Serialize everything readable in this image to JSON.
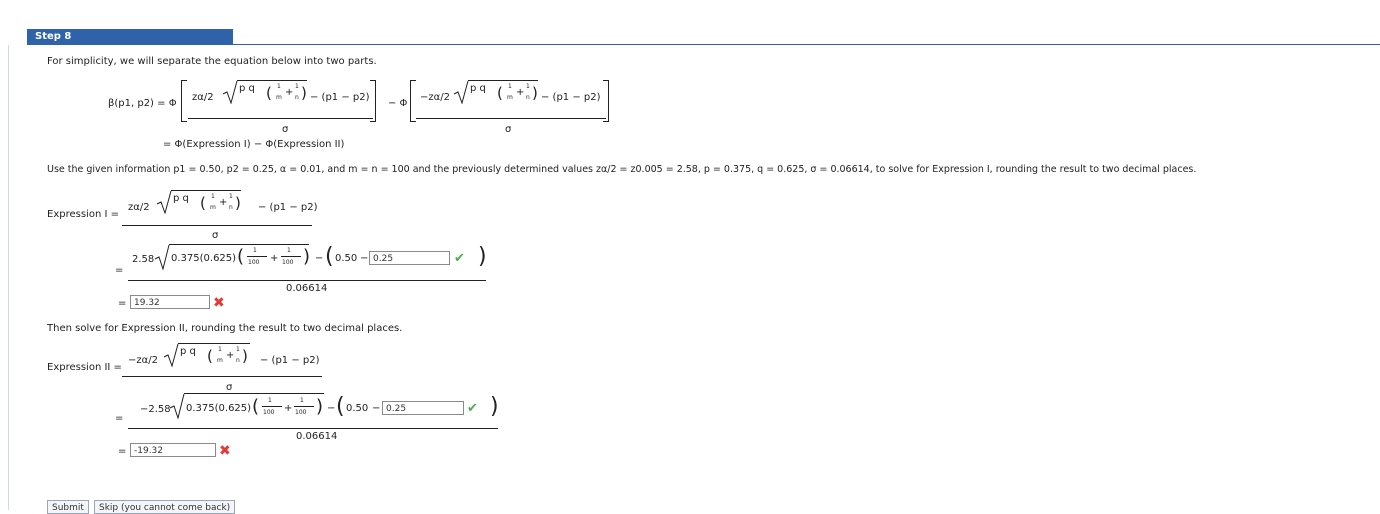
{
  "step": {
    "label": "Step 8"
  },
  "intro": "For simplicity, we will separate the equation below into two parts.",
  "beta": {
    "lhs": "β(p1, p2) = Φ",
    "num1": {
      "z": "zα/2",
      "pq": "p q",
      "minus_p": "− (p1 − p2)"
    },
    "minus_phi": "− Φ",
    "num2": {
      "z": "−zα/2",
      "pq": "p q",
      "minus_p": "− (p1 − p2)"
    },
    "sigma": "σ",
    "second_line": "= Φ(Expression I) − Φ(Expression II)"
  },
  "given_info": "Use the given information p1 = 0.50, p2 = 0.25, α = 0.01, and m = n = 100 and the previously determined values zα/2 = z0.005 = 2.58, p = 0.375, q = 0.625, σ = 0.06614, to solve for Expression I, rounding the result to two decimal places.",
  "expr1": {
    "label": "Expression I =",
    "z": "zα/2",
    "pq": "p q",
    "minus_p": "− (p1 − p2)",
    "sigma": "σ",
    "sub_eq": "=",
    "coef": "2.58",
    "under": "0.375(0.625)",
    "one": "1",
    "hundred": "100",
    "plus": "+",
    "minus": "−",
    "p1_val": "0.50",
    "p2_input": "0.25",
    "denom": "0.06614",
    "result_eq": "=",
    "result_input": "19.32"
  },
  "then_text": "Then solve for Expression II, rounding the result to two decimal places.",
  "expr2": {
    "label": "Expression II =",
    "z": "−zα/2",
    "pq": "p q",
    "minus_p": "− (p1 − p2)",
    "sigma": "σ",
    "sub_eq": "=",
    "coef": "−2.58",
    "under": "0.375(0.625)",
    "one": "1",
    "hundred": "100",
    "plus": "+",
    "minus": "−",
    "p1_val": "0.50",
    "p2_input": "0.25",
    "denom": "0.06614",
    "result_eq": "=",
    "result_input": "-19.32"
  },
  "buttons": {
    "submit": "Submit",
    "skip": "Skip (you cannot come back)"
  },
  "icons": {
    "check": "check-icon",
    "wrong": "x-icon"
  },
  "colors": {
    "accent": "#2f62a8",
    "correct": "#4caf50",
    "wrong": "#e53935"
  }
}
